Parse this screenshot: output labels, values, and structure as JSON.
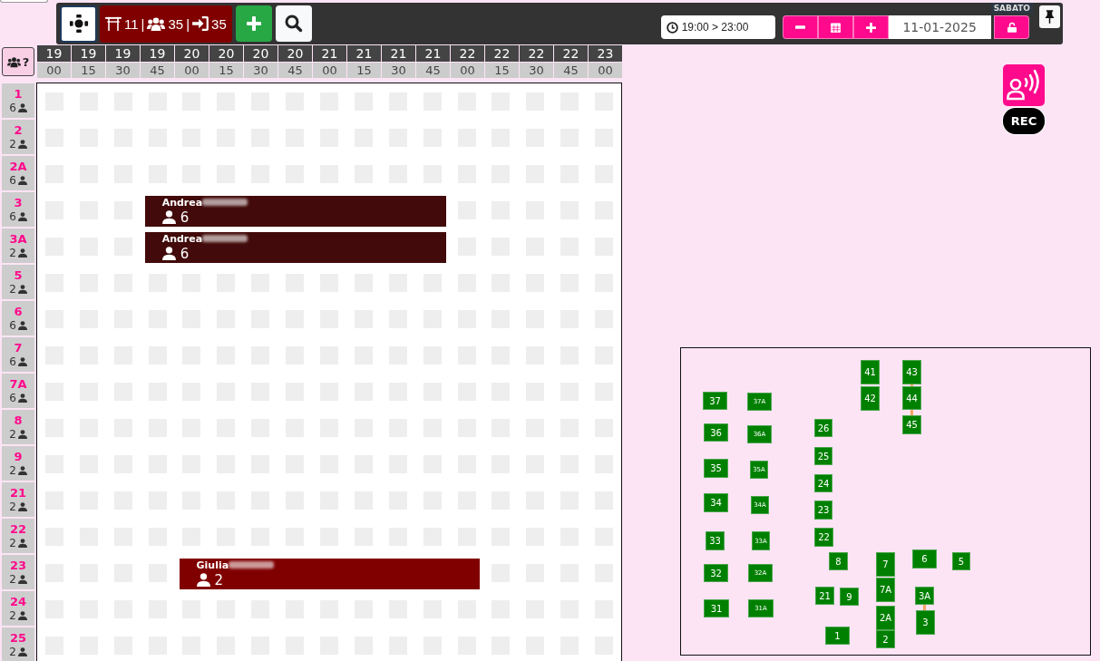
{
  "toolbar": {
    "stats": [
      {
        "kind": "tables",
        "value": "11",
        "separator": "|"
      },
      {
        "kind": "guests",
        "value": "35",
        "separator": "|"
      },
      {
        "kind": "arrivals",
        "value": "35"
      }
    ],
    "time_range": "19:00 > 23:00",
    "weekday": "SABATO",
    "date": "11-01-2025",
    "locked": false
  },
  "schedule": {
    "group_button": {
      "label": "?"
    },
    "time_columns": [
      {
        "hour": "19",
        "minute": "00"
      },
      {
        "hour": "19",
        "minute": "15"
      },
      {
        "hour": "19",
        "minute": "30"
      },
      {
        "hour": "19",
        "minute": "45"
      },
      {
        "hour": "20",
        "minute": "00"
      },
      {
        "hour": "20",
        "minute": "15"
      },
      {
        "hour": "20",
        "minute": "30"
      },
      {
        "hour": "20",
        "minute": "45"
      },
      {
        "hour": "21",
        "minute": "00"
      },
      {
        "hour": "21",
        "minute": "15"
      },
      {
        "hour": "21",
        "minute": "30"
      },
      {
        "hour": "21",
        "minute": "45"
      },
      {
        "hour": "22",
        "minute": "00"
      },
      {
        "hour": "22",
        "minute": "15"
      },
      {
        "hour": "22",
        "minute": "30"
      },
      {
        "hour": "22",
        "minute": "45"
      },
      {
        "hour": "23",
        "minute": "00"
      }
    ],
    "tables": [
      {
        "label": "1",
        "seats": "6",
        "timeline": [
          {
            "kind": "free"
          },
          {
            "kind": "free"
          },
          {
            "kind": "free"
          },
          {
            "kind": "free"
          },
          {
            "kind": "free"
          },
          {
            "kind": "free"
          },
          {
            "kind": "free"
          },
          {
            "kind": "free"
          },
          {
            "kind": "free"
          },
          {
            "kind": "free"
          },
          {
            "kind": "free"
          },
          {
            "kind": "free"
          },
          {
            "kind": "free"
          },
          {
            "kind": "free"
          },
          {
            "kind": "free"
          },
          {
            "kind": "free"
          },
          {
            "kind": "free"
          }
        ]
      },
      {
        "label": "2",
        "seats": "2",
        "timeline": [
          {
            "kind": "free"
          },
          {
            "kind": "free"
          },
          {
            "kind": "free"
          },
          {
            "kind": "free"
          },
          {
            "kind": "free"
          },
          {
            "kind": "free"
          },
          {
            "kind": "free"
          },
          {
            "kind": "free"
          },
          {
            "kind": "free"
          },
          {
            "kind": "free"
          },
          {
            "kind": "free"
          },
          {
            "kind": "free"
          },
          {
            "kind": "free"
          },
          {
            "kind": "free"
          },
          {
            "kind": "free"
          },
          {
            "kind": "free"
          },
          {
            "kind": "free"
          }
        ]
      },
      {
        "label": "2A",
        "seats": "6",
        "timeline": [
          {
            "kind": "free"
          },
          {
            "kind": "free"
          },
          {
            "kind": "free"
          },
          {
            "kind": "free"
          },
          {
            "kind": "free"
          },
          {
            "kind": "free"
          },
          {
            "kind": "free"
          },
          {
            "kind": "free"
          },
          {
            "kind": "free"
          },
          {
            "kind": "free"
          },
          {
            "kind": "free"
          },
          {
            "kind": "free"
          },
          {
            "kind": "free"
          },
          {
            "kind": "free"
          },
          {
            "kind": "free"
          },
          {
            "kind": "free"
          },
          {
            "kind": "free"
          }
        ]
      },
      {
        "label": "3",
        "seats": "6",
        "timeline": [
          {
            "kind": "free"
          },
          {
            "kind": "free"
          },
          {
            "kind": "free"
          },
          {
            "kind": "booking",
            "name": "Andrea",
            "surname_hidden": true,
            "guests": "6",
            "color": "#420a0a"
          },
          {
            "kind": "continued"
          },
          {
            "kind": "continued"
          },
          {
            "kind": "continued"
          },
          {
            "kind": "continued"
          },
          {
            "kind": "continued"
          },
          {
            "kind": "continued"
          },
          {
            "kind": "continued"
          },
          {
            "kind": "continued"
          },
          {
            "kind": "free"
          },
          {
            "kind": "free"
          },
          {
            "kind": "free"
          },
          {
            "kind": "free"
          },
          {
            "kind": "free"
          }
        ]
      },
      {
        "label": "3A",
        "seats": "2",
        "timeline": [
          {
            "kind": "free"
          },
          {
            "kind": "free"
          },
          {
            "kind": "free"
          },
          {
            "kind": "booking",
            "name": "Andrea",
            "surname_hidden": true,
            "guests": "6",
            "color": "#420a0a"
          },
          {
            "kind": "continued"
          },
          {
            "kind": "continued"
          },
          {
            "kind": "continued"
          },
          {
            "kind": "continued"
          },
          {
            "kind": "continued"
          },
          {
            "kind": "continued"
          },
          {
            "kind": "continued"
          },
          {
            "kind": "continued"
          },
          {
            "kind": "free"
          },
          {
            "kind": "free"
          },
          {
            "kind": "free"
          },
          {
            "kind": "free"
          },
          {
            "kind": "free"
          }
        ]
      },
      {
        "label": "5",
        "seats": "2",
        "timeline": [
          {
            "kind": "free"
          },
          {
            "kind": "free"
          },
          {
            "kind": "free"
          },
          {
            "kind": "free"
          },
          {
            "kind": "free"
          },
          {
            "kind": "free"
          },
          {
            "kind": "free"
          },
          {
            "kind": "free"
          },
          {
            "kind": "free"
          },
          {
            "kind": "free"
          },
          {
            "kind": "free"
          },
          {
            "kind": "free"
          },
          {
            "kind": "free"
          },
          {
            "kind": "free"
          },
          {
            "kind": "free"
          },
          {
            "kind": "free"
          },
          {
            "kind": "free"
          }
        ]
      },
      {
        "label": "6",
        "seats": "6",
        "timeline": [
          {
            "kind": "free"
          },
          {
            "kind": "free"
          },
          {
            "kind": "free"
          },
          {
            "kind": "free"
          },
          {
            "kind": "free"
          },
          {
            "kind": "free"
          },
          {
            "kind": "free"
          },
          {
            "kind": "free"
          },
          {
            "kind": "free"
          },
          {
            "kind": "free"
          },
          {
            "kind": "free"
          },
          {
            "kind": "free"
          },
          {
            "kind": "free"
          },
          {
            "kind": "free"
          },
          {
            "kind": "free"
          },
          {
            "kind": "free"
          },
          {
            "kind": "free"
          }
        ]
      },
      {
        "label": "7",
        "seats": "6",
        "timeline": [
          {
            "kind": "free"
          },
          {
            "kind": "free"
          },
          {
            "kind": "free"
          },
          {
            "kind": "free"
          },
          {
            "kind": "free"
          },
          {
            "kind": "free"
          },
          {
            "kind": "free"
          },
          {
            "kind": "free"
          },
          {
            "kind": "free"
          },
          {
            "kind": "free"
          },
          {
            "kind": "free"
          },
          {
            "kind": "free"
          },
          {
            "kind": "free"
          },
          {
            "kind": "free"
          },
          {
            "kind": "free"
          },
          {
            "kind": "free"
          },
          {
            "kind": "free"
          }
        ]
      },
      {
        "label": "7A",
        "seats": "6",
        "timeline": [
          {
            "kind": "free"
          },
          {
            "kind": "free"
          },
          {
            "kind": "free"
          },
          {
            "kind": "free"
          },
          {
            "kind": "free"
          },
          {
            "kind": "free"
          },
          {
            "kind": "free"
          },
          {
            "kind": "free"
          },
          {
            "kind": "free"
          },
          {
            "kind": "free"
          },
          {
            "kind": "free"
          },
          {
            "kind": "free"
          },
          {
            "kind": "free"
          },
          {
            "kind": "free"
          },
          {
            "kind": "free"
          },
          {
            "kind": "free"
          },
          {
            "kind": "free"
          }
        ]
      },
      {
        "label": "8",
        "seats": "2",
        "timeline": [
          {
            "kind": "free"
          },
          {
            "kind": "free"
          },
          {
            "kind": "free"
          },
          {
            "kind": "free"
          },
          {
            "kind": "free"
          },
          {
            "kind": "free"
          },
          {
            "kind": "free"
          },
          {
            "kind": "free"
          },
          {
            "kind": "free"
          },
          {
            "kind": "free"
          },
          {
            "kind": "free"
          },
          {
            "kind": "free"
          },
          {
            "kind": "free"
          },
          {
            "kind": "free"
          },
          {
            "kind": "free"
          },
          {
            "kind": "free"
          },
          {
            "kind": "free"
          }
        ]
      },
      {
        "label": "9",
        "seats": "2",
        "timeline": [
          {
            "kind": "free"
          },
          {
            "kind": "free"
          },
          {
            "kind": "free"
          },
          {
            "kind": "free"
          },
          {
            "kind": "free"
          },
          {
            "kind": "free"
          },
          {
            "kind": "free"
          },
          {
            "kind": "free"
          },
          {
            "kind": "free"
          },
          {
            "kind": "free"
          },
          {
            "kind": "free"
          },
          {
            "kind": "free"
          },
          {
            "kind": "free"
          },
          {
            "kind": "free"
          },
          {
            "kind": "free"
          },
          {
            "kind": "free"
          },
          {
            "kind": "free"
          }
        ]
      },
      {
        "label": "21",
        "seats": "2",
        "timeline": [
          {
            "kind": "free"
          },
          {
            "kind": "free"
          },
          {
            "kind": "free"
          },
          {
            "kind": "free"
          },
          {
            "kind": "free"
          },
          {
            "kind": "free"
          },
          {
            "kind": "free"
          },
          {
            "kind": "free"
          },
          {
            "kind": "free"
          },
          {
            "kind": "free"
          },
          {
            "kind": "free"
          },
          {
            "kind": "free"
          },
          {
            "kind": "free"
          },
          {
            "kind": "free"
          },
          {
            "kind": "free"
          },
          {
            "kind": "free"
          },
          {
            "kind": "free"
          }
        ]
      },
      {
        "label": "22",
        "seats": "2",
        "timeline": [
          {
            "kind": "free"
          },
          {
            "kind": "free"
          },
          {
            "kind": "free"
          },
          {
            "kind": "free"
          },
          {
            "kind": "free"
          },
          {
            "kind": "free"
          },
          {
            "kind": "free"
          },
          {
            "kind": "free"
          },
          {
            "kind": "free"
          },
          {
            "kind": "free"
          },
          {
            "kind": "free"
          },
          {
            "kind": "free"
          },
          {
            "kind": "free"
          },
          {
            "kind": "free"
          },
          {
            "kind": "free"
          },
          {
            "kind": "free"
          },
          {
            "kind": "free"
          }
        ]
      },
      {
        "label": "23",
        "seats": "2",
        "timeline": [
          {
            "kind": "free"
          },
          {
            "kind": "free"
          },
          {
            "kind": "free"
          },
          {
            "kind": "free"
          },
          {
            "kind": "booking",
            "name": "Giulia",
            "surname_hidden": true,
            "guests": "2",
            "color": "#800000"
          },
          {
            "kind": "continued"
          },
          {
            "kind": "continued"
          },
          {
            "kind": "continued"
          },
          {
            "kind": "continued"
          },
          {
            "kind": "continued"
          },
          {
            "kind": "continued"
          },
          {
            "kind": "continued"
          },
          {
            "kind": "continued"
          },
          {
            "kind": "free"
          },
          {
            "kind": "free"
          },
          {
            "kind": "free"
          },
          {
            "kind": "free"
          }
        ]
      },
      {
        "label": "24",
        "seats": "2",
        "timeline": [
          {
            "kind": "free"
          },
          {
            "kind": "free"
          },
          {
            "kind": "free"
          },
          {
            "kind": "free"
          },
          {
            "kind": "free"
          },
          {
            "kind": "free"
          },
          {
            "kind": "free"
          },
          {
            "kind": "free"
          },
          {
            "kind": "free"
          },
          {
            "kind": "free"
          },
          {
            "kind": "free"
          },
          {
            "kind": "free"
          },
          {
            "kind": "free"
          },
          {
            "kind": "free"
          },
          {
            "kind": "free"
          },
          {
            "kind": "free"
          },
          {
            "kind": "free"
          }
        ]
      },
      {
        "label": "25",
        "seats": "2",
        "timeline": [
          {
            "kind": "free"
          },
          {
            "kind": "free"
          },
          {
            "kind": "free"
          },
          {
            "kind": "free"
          },
          {
            "kind": "free"
          },
          {
            "kind": "free"
          },
          {
            "kind": "free"
          },
          {
            "kind": "free"
          },
          {
            "kind": "free"
          },
          {
            "kind": "free"
          },
          {
            "kind": "free"
          },
          {
            "kind": "free"
          },
          {
            "kind": "free"
          },
          {
            "kind": "free"
          },
          {
            "kind": "free"
          },
          {
            "kind": "free"
          },
          {
            "kind": "free"
          }
        ]
      }
    ]
  },
  "voice_button": {
    "label": "REC"
  },
  "floor_plan": {
    "tables": [
      {
        "label": "41",
        "linked_below": false
      },
      {
        "label": "43",
        "linked_below": true
      },
      {
        "label": "37",
        "linked_below": false
      },
      {
        "label": "37A",
        "linked_below": false
      },
      {
        "label": "42",
        "linked_below": false
      },
      {
        "label": "44",
        "linked_below": true
      },
      {
        "label": "36",
        "linked_below": false
      },
      {
        "label": "36A",
        "linked_below": false
      },
      {
        "label": "26",
        "linked_below": false
      },
      {
        "label": "45",
        "linked_below": false
      },
      {
        "label": "25",
        "linked_below": false
      },
      {
        "label": "35",
        "linked_below": false
      },
      {
        "label": "35A",
        "linked_below": false
      },
      {
        "label": "24",
        "linked_below": false
      },
      {
        "label": "34",
        "linked_below": false
      },
      {
        "label": "34A",
        "linked_below": false
      },
      {
        "label": "23",
        "linked_below": false
      },
      {
        "label": "33",
        "linked_below": false
      },
      {
        "label": "33A",
        "linked_below": false
      },
      {
        "label": "22",
        "linked_below": false
      },
      {
        "label": "8",
        "linked_below": false
      },
      {
        "label": "7",
        "linked_below": false
      },
      {
        "label": "6",
        "linked_below": false
      },
      {
        "label": "5",
        "linked_below": false
      },
      {
        "label": "32",
        "linked_below": false
      },
      {
        "label": "32A",
        "linked_below": false
      },
      {
        "label": "21",
        "linked_below": false
      },
      {
        "label": "9",
        "linked_below": false
      },
      {
        "label": "7A",
        "linked_below": false
      },
      {
        "label": "3A",
        "linked_below": true
      },
      {
        "label": "31",
        "linked_below": false
      },
      {
        "label": "31A",
        "linked_below": false
      },
      {
        "label": "2A",
        "linked_below": false
      },
      {
        "label": "3",
        "linked_below": false
      },
      {
        "label": "1",
        "linked_below": false
      },
      {
        "label": "2",
        "linked_below": false
      }
    ]
  }
}
